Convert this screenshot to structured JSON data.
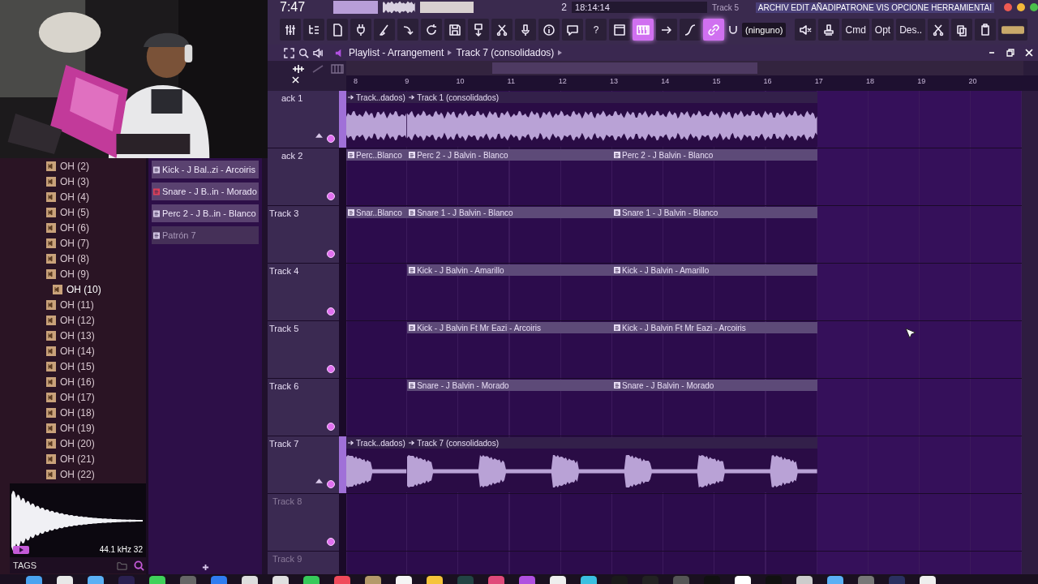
{
  "top_bar": {
    "time": "7:47",
    "pattern_number": "2",
    "clock": "18:14:14",
    "track_label": "Track 5",
    "hint": "ARCHIV EDIT AÑADIPATRONE VIS OPCIONE HERRAMIENTAI"
  },
  "toolbar": [
    {
      "kind": "icon",
      "on": false
    },
    {
      "kind": "icon",
      "on": false
    },
    {
      "kind": "icon",
      "on": false
    },
    {
      "kind": "icon",
      "on": false
    },
    {
      "kind": "icon",
      "on": false
    },
    {
      "kind": "icon",
      "on": false
    },
    {
      "kind": "icon",
      "on": false
    },
    {
      "kind": "icon",
      "on": false
    },
    {
      "kind": "icon",
      "on": false
    },
    {
      "kind": "icon",
      "on": false
    },
    {
      "kind": "icon",
      "on": false
    },
    {
      "kind": "icon",
      "on": false
    },
    {
      "kind": "icon",
      "on": false
    },
    {
      "kind": "text",
      "label": "?",
      "on": false
    },
    {
      "kind": "icon",
      "on": false
    },
    {
      "kind": "icon",
      "on": true
    },
    {
      "kind": "icon",
      "on": false
    },
    {
      "kind": "icon",
      "on": false
    },
    {
      "kind": "icon",
      "on": true
    },
    {
      "kind": "icon",
      "on": false
    },
    {
      "kind": "field",
      "label": "(ninguno)"
    },
    {
      "kind": "icon",
      "on": false
    },
    {
      "kind": "icon",
      "on": false
    },
    {
      "kind": "text",
      "label": "Cmd",
      "on": false
    },
    {
      "kind": "text",
      "label": "Opt",
      "on": false
    },
    {
      "kind": "text",
      "label": "Des..",
      "on": false
    },
    {
      "kind": "icon",
      "on": false
    },
    {
      "kind": "icon",
      "on": false
    },
    {
      "kind": "icon",
      "on": false
    },
    {
      "kind": "icon",
      "on": false
    }
  ],
  "playlist": {
    "title": "Playlist - Arrangement",
    "breadcrumb": "Track 7 (consolidados)",
    "ruler": [
      "8",
      "9",
      "10",
      "11",
      "12",
      "13",
      "14",
      "15",
      "16",
      "17",
      "18",
      "19",
      "20"
    ],
    "tracks": [
      {
        "name": "ack 1",
        "dim": false,
        "clips": [
          {
            "kind": "audio",
            "label": "Track..dados)"
          },
          {
            "kind": "audio",
            "label": "Track 1 (consolidados)"
          }
        ]
      },
      {
        "name": "ack 2",
        "dim": false,
        "clips": [
          {
            "kind": "pattern",
            "label": "Perc..Blanco"
          },
          {
            "kind": "pattern",
            "label": "Perc 2 - J Balvin - Blanco"
          },
          {
            "kind": "pattern",
            "label": "Perc 2 - J Balvin - Blanco"
          }
        ]
      },
      {
        "name": "Track 3",
        "dim": false,
        "clips": [
          {
            "kind": "pattern",
            "label": "Snar..Blanco"
          },
          {
            "kind": "pattern",
            "label": "Snare 1 - J Balvin - Blanco"
          },
          {
            "kind": "pattern",
            "label": "Snare 1 - J Balvin - Blanco"
          }
        ]
      },
      {
        "name": "Track 4",
        "dim": false,
        "clips": [
          {
            "kind": "pattern",
            "label": "Kick - J Balvin - Amarillo"
          },
          {
            "kind": "pattern",
            "label": "Kick - J Balvin - Amarillo"
          }
        ]
      },
      {
        "name": "Track 5",
        "dim": false,
        "clips": [
          {
            "kind": "pattern",
            "label": "Kick - J Balvin Ft Mr Eazi - Arcoiris"
          },
          {
            "kind": "pattern",
            "label": "Kick - J Balvin Ft Mr Eazi - Arcoiris"
          }
        ]
      },
      {
        "name": "Track 6",
        "dim": false,
        "clips": [
          {
            "kind": "pattern",
            "label": "Snare - J Balvin - Morado"
          },
          {
            "kind": "pattern",
            "label": "Snare - J Balvin - Morado"
          }
        ]
      },
      {
        "name": "Track 7",
        "dim": false,
        "clips": [
          {
            "kind": "audio",
            "label": "Track..dados)"
          },
          {
            "kind": "audio",
            "label": "Track 7 (consolidados)"
          }
        ]
      },
      {
        "name": "Track 8",
        "dim": true
      },
      {
        "name": "Track 9",
        "dim": true
      }
    ]
  },
  "browser": {
    "items": [
      {
        "label": "OH (2)",
        "selected": false
      },
      {
        "label": "OH (3)",
        "selected": false
      },
      {
        "label": "OH (4)",
        "selected": false
      },
      {
        "label": "OH (5)",
        "selected": false
      },
      {
        "label": "OH (6)",
        "selected": false
      },
      {
        "label": "OH (7)",
        "selected": false
      },
      {
        "label": "OH (8)",
        "selected": false
      },
      {
        "label": "OH (9)",
        "selected": false
      },
      {
        "label": "OH (10)",
        "selected": true
      },
      {
        "label": "OH (11)",
        "selected": false
      },
      {
        "label": "OH (12)",
        "selected": false
      },
      {
        "label": "OH (13)",
        "selected": false
      },
      {
        "label": "OH (14)",
        "selected": false
      },
      {
        "label": "OH (15)",
        "selected": false
      },
      {
        "label": "OH (16)",
        "selected": false
      },
      {
        "label": "OH (17)",
        "selected": false
      },
      {
        "label": "OH (18)",
        "selected": false
      },
      {
        "label": "OH (19)",
        "selected": false
      },
      {
        "label": "OH (20)",
        "selected": false
      },
      {
        "label": "OH (21)",
        "selected": false
      },
      {
        "label": "OH (22)",
        "selected": false
      }
    ],
    "sample_info": "44.1 kHz 32",
    "tags_label": "TAGS"
  },
  "patterns": [
    {
      "label": "Kick - J Bal..zi - Arcoiris",
      "color": "#d8cce8",
      "dim": false
    },
    {
      "label": "Snare - J B..in - Morado",
      "color": "#e0405a",
      "dim": false
    },
    {
      "label": "Perc 2 - J B..in - Blanco",
      "color": "#d8cce8",
      "dim": false
    },
    {
      "label": "Patrón 7",
      "color": "#d8cce8",
      "dim": true
    }
  ]
}
